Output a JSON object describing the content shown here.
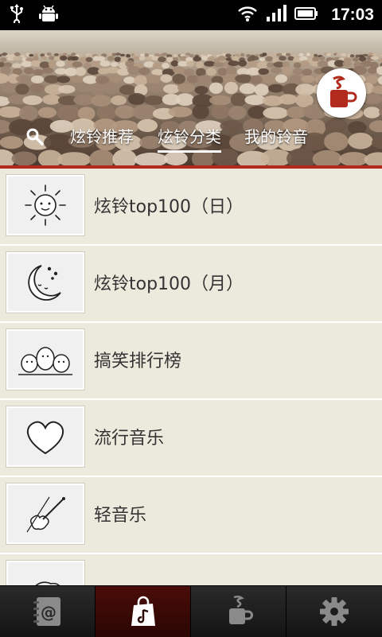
{
  "status_bar": {
    "time": "17:03"
  },
  "header": {
    "tabs": [
      {
        "label": "炫铃推荐",
        "active": false
      },
      {
        "label": "炫铃分类",
        "active": true
      },
      {
        "label": "我的铃音",
        "active": false
      }
    ]
  },
  "list": {
    "items": [
      {
        "label": "炫铃top100（日）",
        "icon": "sun-icon"
      },
      {
        "label": "炫铃top100（月）",
        "icon": "moon-icon"
      },
      {
        "label": "搞笑排行榜",
        "icon": "chicks-icon"
      },
      {
        "label": "流行音乐",
        "icon": "heart-icon"
      },
      {
        "label": "轻音乐",
        "icon": "violin-icon"
      },
      {
        "label": "",
        "icon": "partial-icon"
      }
    ]
  },
  "bottom_nav": {
    "items": [
      {
        "name": "contacts",
        "icon": "address-book-icon",
        "active": false
      },
      {
        "name": "store",
        "icon": "music-bag-icon",
        "active": true
      },
      {
        "name": "coffee",
        "icon": "coffee-cup-icon",
        "active": false
      },
      {
        "name": "settings",
        "icon": "gear-icon",
        "active": false
      }
    ]
  },
  "colors": {
    "accent": "#b22a1c",
    "list_bg": "#ece9dd",
    "nav_bg": "#1b1b1b"
  }
}
